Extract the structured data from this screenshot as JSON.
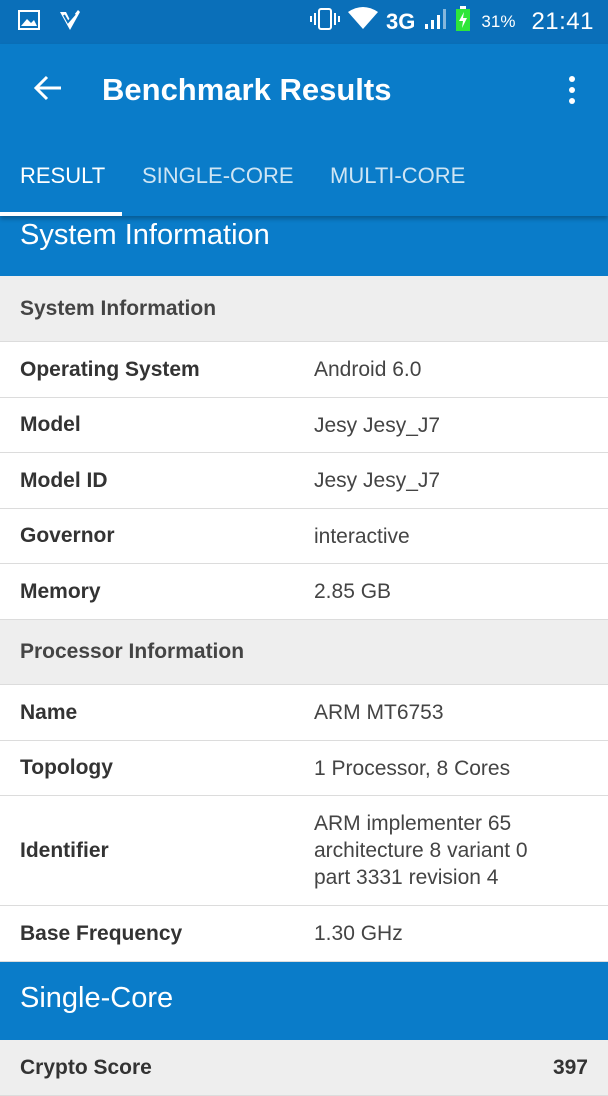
{
  "status_bar": {
    "network": "3G",
    "battery_percent": "31%",
    "time": "21:41",
    "icons": [
      "image-icon",
      "check-shield-icon",
      "vibrate-icon",
      "wifi-icon",
      "signal-icon",
      "battery-charging-icon"
    ]
  },
  "app_bar": {
    "title": "Benchmark Results",
    "back_icon": "arrow-left-icon",
    "overflow_icon": "more-vertical-icon"
  },
  "tabs": [
    {
      "label": "RESULT",
      "active": true
    },
    {
      "label": "SINGLE-CORE",
      "active": false
    },
    {
      "label": "MULTI-CORE",
      "active": false
    }
  ],
  "sections": {
    "system_info_title": "System Information",
    "single_core_title": "Single-Core"
  },
  "system_information": {
    "header": "System Information",
    "rows": [
      {
        "label": "Operating System",
        "value": "Android 6.0"
      },
      {
        "label": "Model",
        "value": "Jesy Jesy_J7"
      },
      {
        "label": "Model ID",
        "value": "Jesy Jesy_J7"
      },
      {
        "label": "Governor",
        "value": "interactive"
      },
      {
        "label": "Memory",
        "value": "2.85 GB"
      }
    ]
  },
  "processor_information": {
    "header": "Processor Information",
    "rows": [
      {
        "label": "Name",
        "value": "ARM MT6753"
      },
      {
        "label": "Topology",
        "value": "1 Processor, 8 Cores"
      },
      {
        "label": "Identifier",
        "value": "ARM implementer 65 architecture 8 variant 0 part 3331 revision 4"
      },
      {
        "label": "Base Frequency",
        "value": "1.30 GHz"
      }
    ]
  },
  "single_core": {
    "rows": [
      {
        "label": "Crypto Score",
        "value": "397"
      }
    ]
  },
  "colors": {
    "primary": "#0a7cc9",
    "status_bar": "#0a6fb9",
    "group_header_bg": "#eeeeee"
  }
}
